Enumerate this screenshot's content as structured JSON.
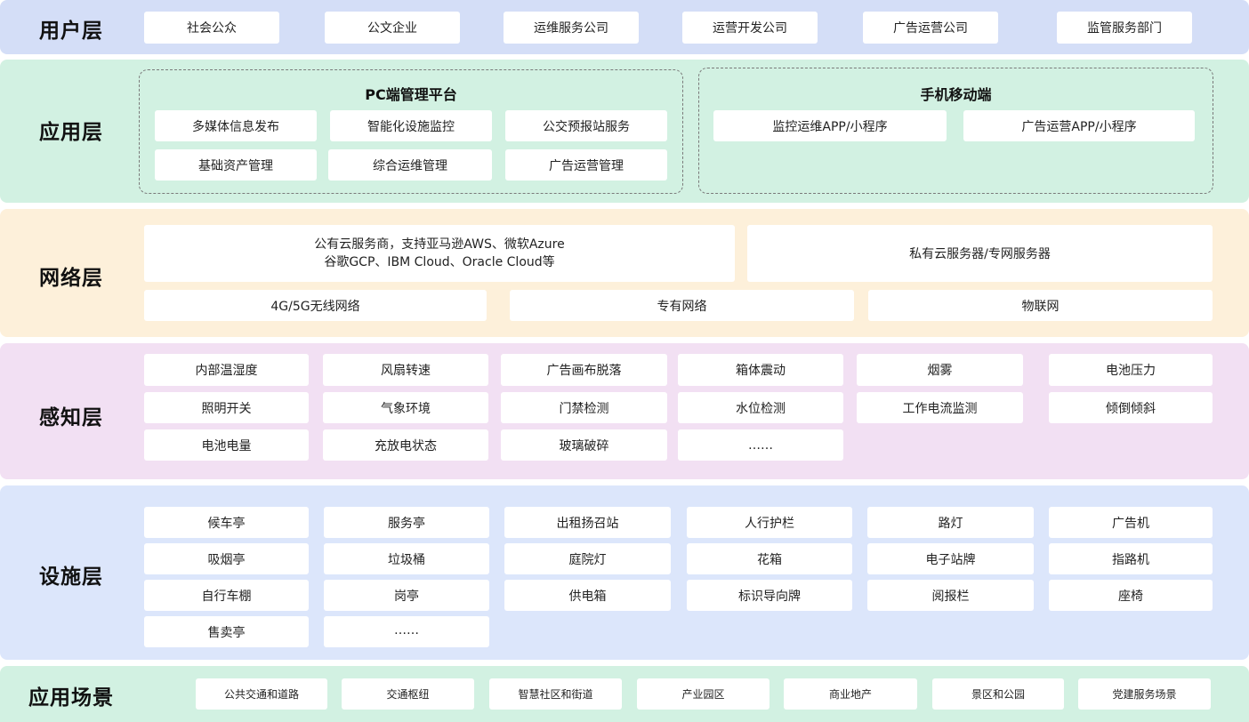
{
  "colors": {
    "user_layer": "#d4def7",
    "app_layer": "#d2f1e2",
    "network_layer": "#fdf0da",
    "perception_layer": "#f2e0f3",
    "facility_layer": "#dce6fb",
    "scene_layer": "#d2f1e2"
  },
  "user_layer": {
    "title": "用户层",
    "items": [
      "社会公众",
      "公文企业",
      "运维服务公司",
      "运营开发公司",
      "广告运营公司",
      "监管服务部门"
    ]
  },
  "app_layer": {
    "title": "应用层",
    "pc": {
      "title": "PC端管理平台",
      "items": [
        "多媒体信息发布",
        "智能化设施监控",
        "公交预报站服务",
        "基础资产管理",
        "综合运维管理",
        "广告运营管理"
      ]
    },
    "mobile": {
      "title": "手机移动端",
      "items": [
        "监控运维APP/小程序",
        "广告运营APP/小程序"
      ]
    }
  },
  "network_layer": {
    "title": "网络层",
    "public_cloud": {
      "line1": "公有云服务商，支持亚马逊AWS、微软Azure",
      "line2": "谷歌GCP、IBM Cloud、Oracle Cloud等"
    },
    "private_cloud": "私有云服务器/专网服务器",
    "items": [
      "4G/5G无线网络",
      "专有网络",
      "物联网"
    ]
  },
  "perception_layer": {
    "title": "感知层",
    "items": [
      "内部温湿度",
      "风扇转速",
      "广告画布脱落",
      "箱体震动",
      "烟雾",
      "电池压力",
      "照明开关",
      "气象环境",
      "门禁检测",
      "水位检测",
      "工作电流监测",
      "倾倒倾斜",
      "电池电量",
      "充放电状态",
      "玻璃破碎",
      "……"
    ]
  },
  "facility_layer": {
    "title": "设施层",
    "items": [
      "候车亭",
      "服务亭",
      "出租扬召站",
      "人行护栏",
      "路灯",
      "广告机",
      "吸烟亭",
      "垃圾桶",
      "庭院灯",
      "花箱",
      "电子站牌",
      "指路机",
      "自行车棚",
      "岗亭",
      "供电箱",
      "标识导向牌",
      "阅报栏",
      "座椅",
      "售卖亭",
      "……"
    ]
  },
  "scene_layer": {
    "title": "应用场景",
    "items": [
      "公共交通和道路",
      "交通枢纽",
      "智慧社区和街道",
      "产业园区",
      "商业地产",
      "景区和公园",
      "党建服务场景"
    ]
  }
}
